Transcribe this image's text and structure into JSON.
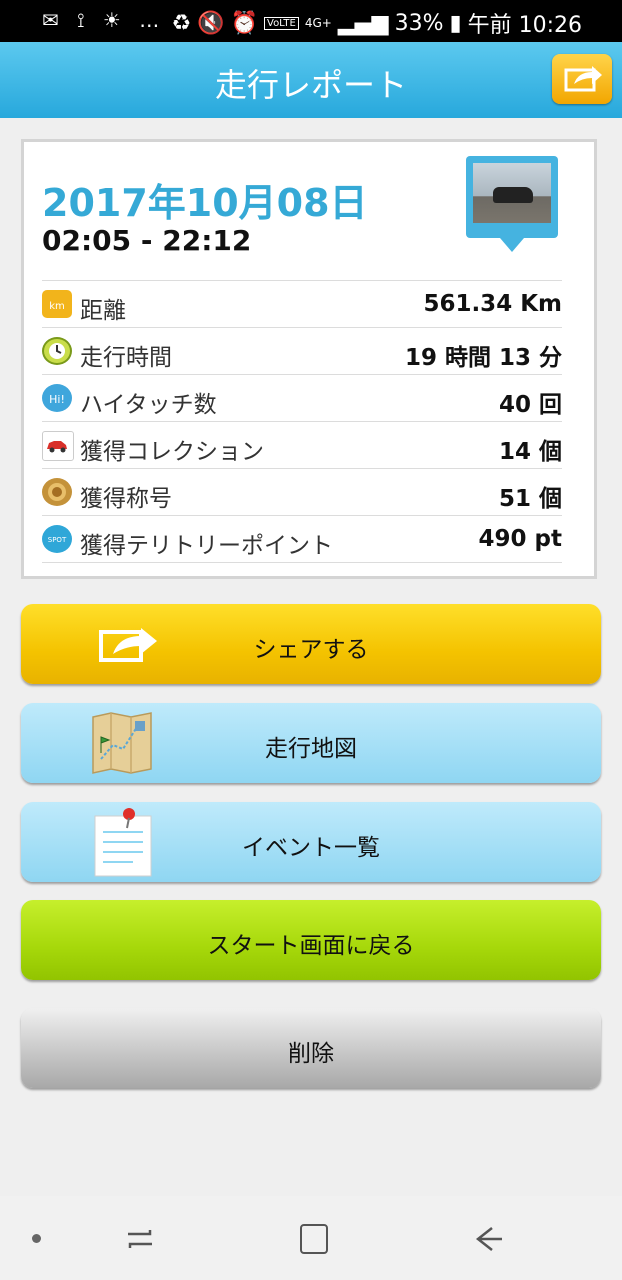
{
  "status_bar": {
    "left_icons": "✉ ⟟ ☀ …",
    "volte": "VoLTE",
    "network": "4G+",
    "battery": "33%",
    "time": "午前 10:26"
  },
  "app_bar": {
    "title": "走行レポート",
    "share_icon": "share-icon"
  },
  "report": {
    "date": "2017年10月08日",
    "time_range": "02:05 - 22:12",
    "rows": [
      {
        "icon": "km-icon",
        "label": "距離",
        "value": "561.34 Km"
      },
      {
        "icon": "clock-icon",
        "label": "走行時間",
        "value": "19 時間 13 分"
      },
      {
        "icon": "hi-five-icon",
        "label": "ハイタッチ数",
        "value": "40 回"
      },
      {
        "icon": "car-icon",
        "label": "獲得コレクション",
        "value": "14 個"
      },
      {
        "icon": "title-badge-icon",
        "label": "獲得称号",
        "value": "51 個"
      },
      {
        "icon": "spot-icon",
        "label": "獲得テリトリーポイント",
        "value": "490 pt"
      }
    ]
  },
  "buttons": {
    "share": "シェアする",
    "map": "走行地図",
    "events": "イベント一覧",
    "back_to_start": "スタート画面に戻る",
    "delete": "削除"
  },
  "colors": {
    "header": "#27a8dc",
    "date_text": "#35a9d6",
    "share_button": "#f4c300",
    "blue_button": "#8fd6f2",
    "green_button": "#a6d80a",
    "gray_button": "#c4c4c4"
  }
}
